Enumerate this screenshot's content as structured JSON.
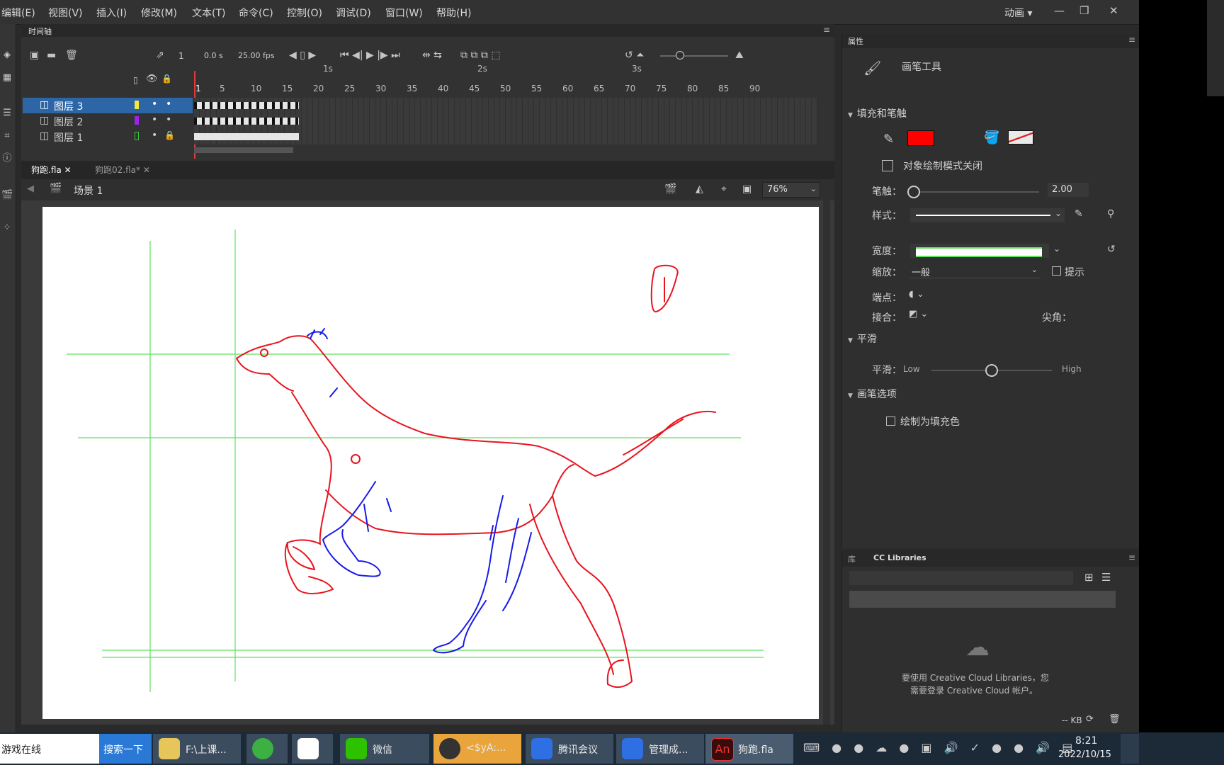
{
  "menu": {
    "items": [
      "编辑(E)",
      "视图(V)",
      "插入(I)",
      "修改(M)",
      "文本(T)",
      "命令(C)",
      "控制(O)",
      "调试(D)",
      "窗口(W)",
      "帮助(H)"
    ],
    "workspace": "动画"
  },
  "timeline": {
    "tab": "时间轴",
    "current_frame": "1",
    "time": "0.0 s",
    "fps": "25.00 fps",
    "seconds": [
      "1s",
      "2s",
      "3s"
    ],
    "ruler": [
      "1",
      "5",
      "10",
      "15",
      "20",
      "25",
      "30",
      "35",
      "40",
      "45",
      "50",
      "55",
      "60",
      "65",
      "70",
      "75",
      "80",
      "85",
      "90"
    ],
    "layers": [
      {
        "name": "图层 3",
        "color": "#f5e642",
        "selected": true
      },
      {
        "name": "图层 2",
        "color": "#a020f0",
        "selected": false
      },
      {
        "name": "图层 1",
        "color": "#3cc83c",
        "selected": false
      }
    ]
  },
  "docs": {
    "tabs": [
      "狗跑.fla",
      "狗跑02.fla*"
    ],
    "scene": "场景 1",
    "zoom": "76%"
  },
  "props": {
    "tab": "属性",
    "tool_name": "画笔工具",
    "section_fill": "填充和笔触",
    "stroke_color": "#ff0000",
    "object_mode": "对象绘制模式关闭",
    "stroke_label": "笔触：",
    "stroke_value": "2.00",
    "style_label": "样式：",
    "width_label": "宽度：",
    "scale_label": "缩放：",
    "scale_value": "一般",
    "hint_label": "提示",
    "cap_label": "端点：",
    "join_label": "接合：",
    "miter_label": "尖角：",
    "section_smooth": "平滑",
    "smooth_label": "平滑：",
    "smooth_low": "Low",
    "smooth_high": "High",
    "section_brush": "画笔选项",
    "draw_as_fill": "绘制为填充色"
  },
  "libs": {
    "tab_lib": "库",
    "tab_cc": "CC Libraries",
    "msg_line1": "要使用 Creative Cloud Libraries，您",
    "msg_line2": "需要登录 Creative Cloud 帐户。",
    "kb": "-- KB"
  },
  "taskbar": {
    "search_text": "游戏在线",
    "search_button": "搜索一下",
    "tasks": [
      "F:\\上课...",
      "",
      "",
      "微信",
      "<$yA:...",
      "腾讯会议",
      "管理成...",
      "狗跑.fla"
    ],
    "time": "8:21",
    "date": "2022/10/15"
  }
}
